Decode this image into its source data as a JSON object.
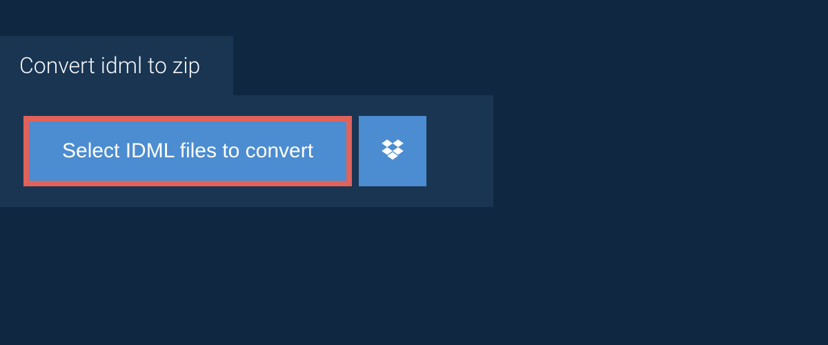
{
  "header": {
    "title": "Convert idml to zip"
  },
  "actions": {
    "select_label": "Select IDML files to convert"
  },
  "colors": {
    "background": "#0f2740",
    "panel": "#1a3552",
    "button": "#4c8cd1",
    "highlight_border": "#e0625a",
    "text_light": "#f5f7fa"
  }
}
